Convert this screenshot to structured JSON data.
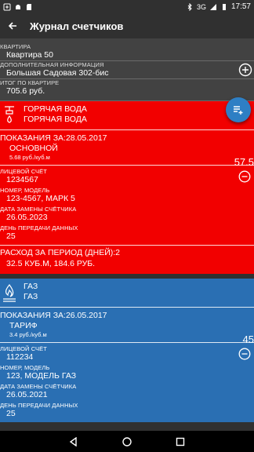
{
  "statusbar": {
    "network": "3G",
    "time": "17:57"
  },
  "appbar": {
    "title": "Журнал счетчиков"
  },
  "apartment": {
    "label": "КВАРТИРА",
    "value": "Квартира 50",
    "extra_label": "ДОПОЛНИТЕЛЬНАЯ ИНФОРМАЦИЯ",
    "extra_value": "Большая Садовая 302-бис",
    "total_label": "ИТОГ ПО КВАРТИРЕ",
    "total_value": "705.6 руб."
  },
  "cards": [
    {
      "name1": "ГОРЯЧАЯ ВОДА",
      "name2": "ГОРЯЧАЯ ВОДА",
      "readings_label": "ПОКАЗАНИЯ ЗА:28.05.2017",
      "tariff_name": "ОСНОВНОЙ",
      "tariff_price": "5.68 руб./куб.м",
      "reading_value": "57.5",
      "account_label": "ЛИЦЕВОЙ СЧЁТ",
      "account_value": "1234567",
      "model_label": "НОМЕР, МОДЕЛЬ",
      "model_value": "123-4567, МАРК 5",
      "replace_label": "ДАТА ЗАМЕНЫ СЧЁТЧИКА",
      "replace_value": "26.05.2023",
      "day_label": "ДЕНЬ ПЕРЕДАЧИ ДАННЫХ",
      "day_value": "25",
      "period_label": "РАСХОД ЗА ПЕРИОД (ДНЕЙ):2",
      "period_value": "32.5 КУБ.М, 184.6 РУБ.",
      "color": "#f20000"
    },
    {
      "name1": "ГАЗ",
      "name2": "ГАЗ",
      "readings_label": "ПОКАЗАНИЯ ЗА:26.05.2017",
      "tariff_name": "ТАРИФ",
      "tariff_price": "3.4 руб./куб.м",
      "reading_value": "45",
      "account_label": "ЛИЦЕВОЙ СЧЁТ",
      "account_value": "112234",
      "model_label": "НОМЕР, МОДЕЛЬ",
      "model_value": "123, МОДЕЛЬ ГАЗ",
      "replace_label": "ДАТА ЗАМЕНЫ СЧЁТЧИКА",
      "replace_value": "26.05.2021",
      "day_label": "ДЕНЬ ПЕРЕДАЧИ ДАННЫХ",
      "day_value": "25",
      "color": "#2a6fb3"
    }
  ],
  "icons": {
    "back": "arrow-back-icon",
    "add": "add-circle-icon",
    "fab": "playlist-add-icon",
    "remove": "remove-circle-icon",
    "water": "water-tap-icon",
    "gas": "flame-icon"
  }
}
